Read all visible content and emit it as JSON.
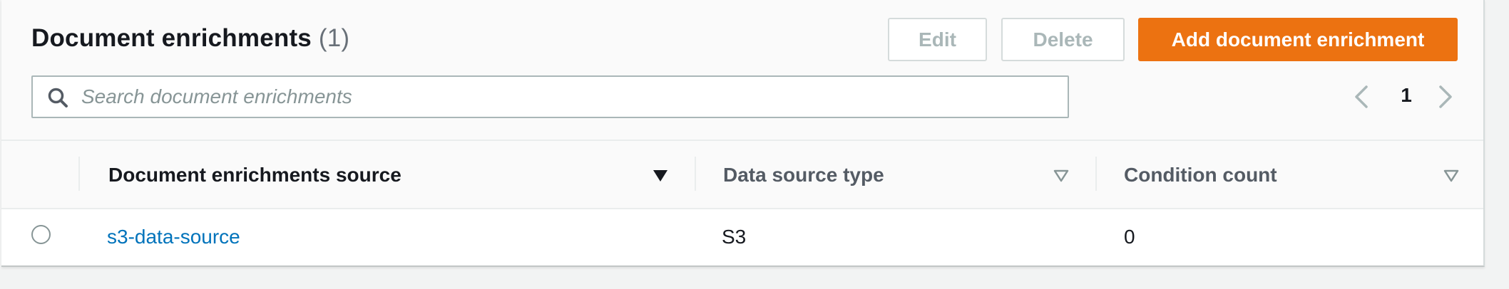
{
  "header": {
    "title": "Document enrichments",
    "count": "(1)"
  },
  "toolbar": {
    "edit_label": "Edit",
    "delete_label": "Delete",
    "add_label": "Add document enrichment"
  },
  "search": {
    "placeholder": "Search document enrichments",
    "value": ""
  },
  "pagination": {
    "current_page": "1"
  },
  "table": {
    "columns": [
      {
        "label": "Document enrichments source",
        "sort": "descending-active"
      },
      {
        "label": "Data source type",
        "sort": "none"
      },
      {
        "label": "Condition count",
        "sort": "none"
      }
    ],
    "rows": [
      {
        "selected": false,
        "source": "s3-data-source",
        "type": "S3",
        "conditions": "0"
      }
    ]
  },
  "colors": {
    "primary": "#ec7211",
    "link": "#0073bb",
    "disabled_text": "#aab7b8"
  },
  "icons": [
    "search-icon",
    "chevron-left-icon",
    "chevron-right-icon",
    "sort-caret-filled-icon",
    "sort-caret-outline-icon"
  ]
}
